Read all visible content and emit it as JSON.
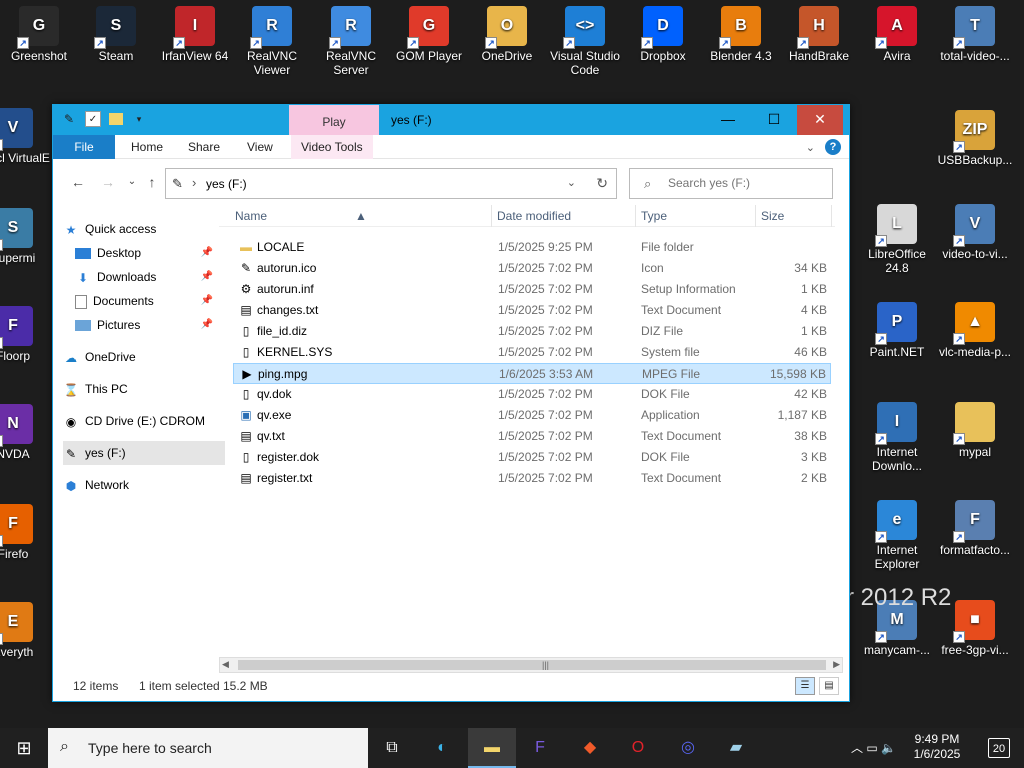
{
  "desktop": {
    "icons_top": [
      {
        "label": "Greenshot",
        "icon": "greenshot-icon",
        "color": "#2a2a2a",
        "glyph": "G"
      },
      {
        "label": "Steam",
        "icon": "steam-icon",
        "color": "#1b2838",
        "glyph": "S"
      },
      {
        "label": "IrfanView 64",
        "icon": "irfanview-icon",
        "color": "#c0262a",
        "glyph": "I"
      },
      {
        "label": "RealVNC Viewer",
        "icon": "realvnc-viewer-icon",
        "color": "#2f7fd6",
        "glyph": "R"
      },
      {
        "label": "RealVNC Server",
        "icon": "realvnc-server-icon",
        "color": "#3f8be0",
        "glyph": "R"
      },
      {
        "label": "GOM Player",
        "icon": "gom-player-icon",
        "color": "#e03a2a",
        "glyph": "G"
      },
      {
        "label": "OneDrive",
        "icon": "onedrive-icon",
        "color": "#e8b54a",
        "glyph": "O"
      },
      {
        "label": "Visual Studio Code",
        "icon": "vscode-icon",
        "color": "#1e7fd6",
        "glyph": "<>"
      },
      {
        "label": "Dropbox",
        "icon": "dropbox-icon",
        "color": "#0061fe",
        "glyph": "D"
      },
      {
        "label": "Blender 4.3",
        "icon": "blender-icon",
        "color": "#e87d0d",
        "glyph": "B"
      },
      {
        "label": "HandBrake",
        "icon": "handbrake-icon",
        "color": "#c5562a",
        "glyph": "H"
      },
      {
        "label": "Avira",
        "icon": "avira-icon",
        "color": "#d6152b",
        "glyph": "A"
      },
      {
        "label": "total-video-...",
        "icon": "installer-icon",
        "color": "#4b7db6",
        "glyph": "T"
      }
    ],
    "icons_left": [
      {
        "label": "Oracl VirtualE",
        "icon": "virtualbox-icon",
        "color": "#234e8c",
        "glyph": "V"
      },
      {
        "label": "Supermi",
        "icon": "supermium-icon",
        "color": "#3a7ca5",
        "glyph": "S"
      },
      {
        "label": "Floorp",
        "icon": "floorp-icon",
        "color": "#4b2ca8",
        "glyph": "F"
      },
      {
        "label": "NVDA",
        "icon": "nvda-icon",
        "color": "#6b2ea6",
        "glyph": "N"
      },
      {
        "label": "Firefo",
        "icon": "firefox-icon",
        "color": "#e66000",
        "glyph": "F"
      },
      {
        "label": "Everyth",
        "icon": "everything-icon",
        "color": "#e07a14",
        "glyph": "E"
      }
    ],
    "icons_right": [
      {
        "label": "USBBackup...",
        "icon": "zip-icon",
        "color": "#d9a33a",
        "glyph": "ZIP"
      },
      {
        "label": "LibreOffice 24.8",
        "icon": "libreoffice-icon",
        "color": "#d8d8d8",
        "glyph": "L"
      },
      {
        "label": "video-to-vi...",
        "icon": "installer-icon",
        "color": "#4b7db6",
        "glyph": "V"
      },
      {
        "label": "Paint.NET",
        "icon": "paintnet-icon",
        "color": "#2a64c8",
        "glyph": "P"
      },
      {
        "label": "vlc-media-p...",
        "icon": "vlc-icon",
        "color": "#f08a00",
        "glyph": "▲"
      },
      {
        "label": "Internet Downlo...",
        "icon": "idm-icon",
        "color": "#2f6fb5",
        "glyph": "I"
      },
      {
        "label": "mypal",
        "icon": "folder-icon",
        "color": "#e8c15a",
        "glyph": ""
      },
      {
        "label": "Internet Explorer",
        "icon": "ie-icon",
        "color": "#2b87d8",
        "glyph": "e"
      },
      {
        "label": "formatfacto...",
        "icon": "formatfactory-icon",
        "color": "#5a7fb0",
        "glyph": "F"
      },
      {
        "label": "manycam-...",
        "icon": "installer-icon",
        "color": "#4b7db6",
        "glyph": "M"
      },
      {
        "label": "free-3gp-vi...",
        "icon": "tiles-icon",
        "color": "#e74c1c",
        "glyph": "■"
      }
    ],
    "wallpaper_text": "r 2012 R2"
  },
  "window": {
    "title": "yes (F:)",
    "context_tab": "Play",
    "minimize": "—",
    "maximize": "☐",
    "close": "✕",
    "ribbon_tabs": {
      "file": "File",
      "home": "Home",
      "share": "Share",
      "view": "View",
      "video_tools": "Video Tools"
    },
    "help": "?",
    "address": "yes (F:)",
    "search_placeholder": "Search yes (F:)"
  },
  "nav": {
    "quick_access": "Quick access",
    "desktop": "Desktop",
    "downloads": "Downloads",
    "documents": "Documents",
    "pictures": "Pictures",
    "onedrive": "OneDrive",
    "this_pc": "This PC",
    "cd_drive": "CD Drive (E:) CDROM",
    "yes_drive": "yes (F:)",
    "network": "Network"
  },
  "columns": {
    "name": "Name",
    "date": "Date modified",
    "type": "Type",
    "size": "Size"
  },
  "files": [
    {
      "name": "LOCALE",
      "date": "1/5/2025 9:25 PM",
      "type": "File folder",
      "size": "",
      "icon": "folder-icon"
    },
    {
      "name": "autorun.ico",
      "date": "1/5/2025 7:02 PM",
      "type": "Icon",
      "size": "34 KB",
      "icon": "drive-icon"
    },
    {
      "name": "autorun.inf",
      "date": "1/5/2025 7:02 PM",
      "type": "Setup Information",
      "size": "1 KB",
      "icon": "settings-file-icon"
    },
    {
      "name": "changes.txt",
      "date": "1/5/2025 7:02 PM",
      "type": "Text Document",
      "size": "4 KB",
      "icon": "text-file-icon"
    },
    {
      "name": "file_id.diz",
      "date": "1/5/2025 7:02 PM",
      "type": "DIZ File",
      "size": "1 KB",
      "icon": "file-icon"
    },
    {
      "name": "KERNEL.SYS",
      "date": "1/5/2025 7:02 PM",
      "type": "System file",
      "size": "46 KB",
      "icon": "system-file-icon"
    },
    {
      "name": "ping.mpg",
      "date": "1/6/2025 3:53 AM",
      "type": "MPEG File",
      "size": "15,598 KB",
      "icon": "video-file-icon",
      "selected": true
    },
    {
      "name": "qv.dok",
      "date": "1/5/2025 7:02 PM",
      "type": "DOK File",
      "size": "42 KB",
      "icon": "file-icon"
    },
    {
      "name": "qv.exe",
      "date": "1/5/2025 7:02 PM",
      "type": "Application",
      "size": "1,187 KB",
      "icon": "app-icon"
    },
    {
      "name": "qv.txt",
      "date": "1/5/2025 7:02 PM",
      "type": "Text Document",
      "size": "38 KB",
      "icon": "text-file-icon"
    },
    {
      "name": "register.dok",
      "date": "1/5/2025 7:02 PM",
      "type": "DOK File",
      "size": "3 KB",
      "icon": "file-icon"
    },
    {
      "name": "register.txt",
      "date": "1/5/2025 7:02 PM",
      "type": "Text Document",
      "size": "2 KB",
      "icon": "text-file-icon"
    }
  ],
  "status": {
    "items": "12 items",
    "selected": "1 item selected",
    "size": "15.2 MB"
  },
  "taskbar": {
    "search_placeholder": "Type here to search",
    "time": "9:49 PM",
    "date": "1/6/2025",
    "notifications": "20"
  },
  "colors": {
    "accent": "#1aa3e0",
    "selection": "#cce8ff",
    "close": "#c74b3f",
    "context_tab": "#f7c6e0"
  }
}
